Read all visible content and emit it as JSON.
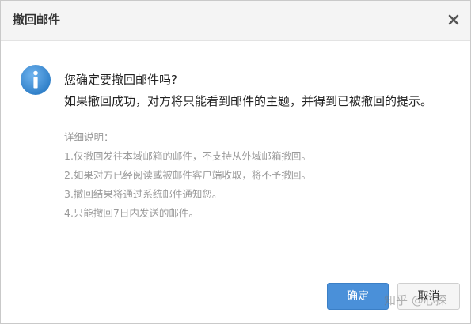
{
  "dialog": {
    "title": "撤回邮件",
    "close_icon": "close-icon",
    "info_icon": "info-icon",
    "message": "您确定要撤回邮件吗?",
    "submessage": "如果撤回成功，对方将只能看到邮件的主题，并得到已被撤回的提示。",
    "details_heading": "详细说明：",
    "details": [
      "1.仅撤回发往本域邮箱的邮件，不支持从外域邮箱撤回。",
      "2.如果对方已经阅读或被邮件客户端收取，将不予撤回。",
      "3.撤回结果将通过系统邮件通知您。",
      "4.只能撤回7日内发送的邮件。"
    ],
    "confirm_label": "确定",
    "cancel_label": "取消"
  },
  "watermark": "知乎 @心探",
  "colors": {
    "accent": "#4a90d9",
    "info_icon": "#3d8fd6",
    "detail_text": "#9a9a9a"
  }
}
